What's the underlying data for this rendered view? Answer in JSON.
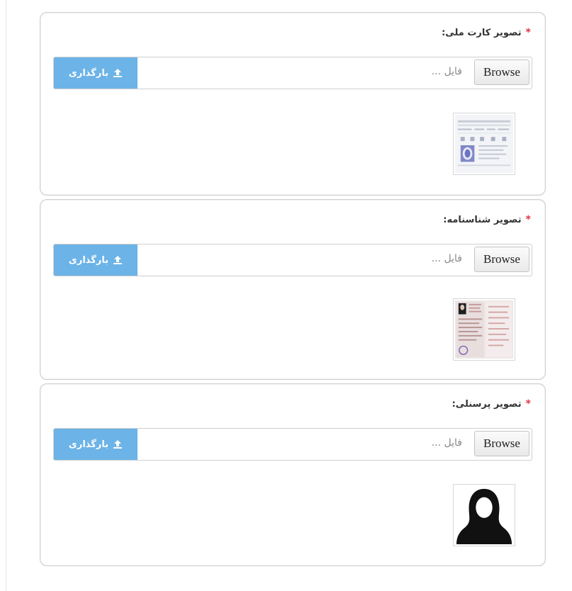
{
  "sections": [
    {
      "label": "تصویر کارت ملی:",
      "required_mark": "*",
      "browse_label": "Browse",
      "file_placeholder": "فایل ...",
      "upload_label": "بارگذاری",
      "upload_icon": "upload-icon",
      "thumbnail": "national-card-image"
    },
    {
      "label": "تصویر شناسنامه:",
      "required_mark": "*",
      "browse_label": "Browse",
      "file_placeholder": "فایل ...",
      "upload_label": "بارگذاری",
      "upload_icon": "upload-icon",
      "thumbnail": "birth-certificate-image"
    },
    {
      "label": "تصویر پرسنلی:",
      "required_mark": "*",
      "browse_label": "Browse",
      "file_placeholder": "فایل ...",
      "upload_label": "بارگذاری",
      "upload_icon": "upload-icon",
      "thumbnail": "personal-photo-image"
    }
  ],
  "colors": {
    "accent": "#6cb3e7",
    "required": "#e0314b",
    "border": "#cfcfcf"
  }
}
